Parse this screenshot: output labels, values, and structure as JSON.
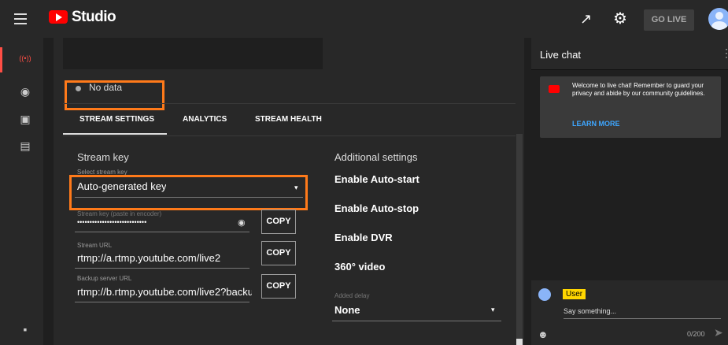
{
  "app": {
    "title": "Studio",
    "go_live": "GO LIVE"
  },
  "icons": {
    "menu": "≡",
    "share": "↗",
    "gear": "⚙",
    "nav": [
      "((•))",
      "◉",
      "▣",
      "▤",
      "▪"
    ]
  },
  "status": {
    "text": "No data"
  },
  "tabs": [
    "STREAM SETTINGS",
    "ANALYTICS",
    "STREAM HEALTH"
  ],
  "stream": {
    "section_title": "Stream key",
    "select_label": "Select stream key",
    "select_value": "Auto-generated key",
    "key_label": "Stream key (paste in encoder)",
    "key_value": "••••••••••••••••••••••••••••",
    "url_label": "Stream URL",
    "url_value": "rtmp://a.rtmp.youtube.com/live2",
    "backup_label": "Backup server URL",
    "backup_value": "rtmp://b.rtmp.youtube.com/live2?backu",
    "copy_label": "COPY"
  },
  "additional": {
    "title": "Additional settings",
    "items": [
      "Enable Auto-start",
      "Enable Auto-stop",
      "Enable DVR",
      "360° video"
    ],
    "delay_label": "Added delay",
    "delay_value": "None"
  },
  "chat": {
    "title": "Live chat",
    "welcome": "Welcome to live chat! Remember to guard your privacy and abide by our community guidelines.",
    "learn_more": "LEARN MORE",
    "user": "User",
    "placeholder": "Say something...",
    "counter": "0/200"
  },
  "colors": {
    "accent": "#ff7a1a",
    "brand": "#ff0000",
    "link": "#3ea6ff"
  }
}
